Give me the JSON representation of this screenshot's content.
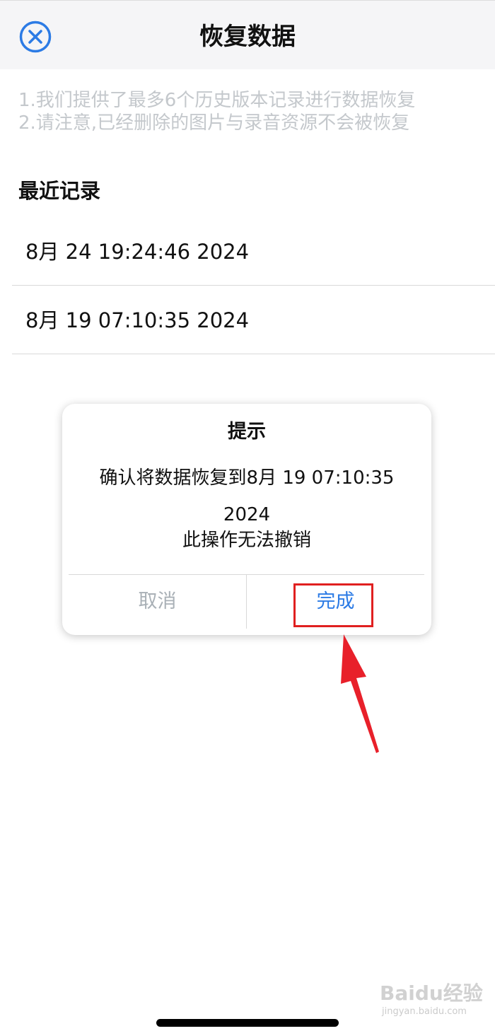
{
  "header": {
    "title": "恢复数据",
    "close_icon": "close-circle-icon",
    "accent_color": "#2c7be5"
  },
  "notes": [
    "1.我们提供了最多6个历史版本记录进行数据恢复",
    "2.请注意,已经删除的图片与录音资源不会被恢复"
  ],
  "recent": {
    "title": "最近记录",
    "records": [
      "8月 24 19:24:46 2024",
      "8月 19 07:10:35 2024"
    ]
  },
  "dialog": {
    "title": "提示",
    "message": "确认将数据恢复到8月 19 07:10:35 2024",
    "sub": "此操作无法撤销",
    "cancel_label": "取消",
    "done_label": "完成"
  },
  "watermark": {
    "text": "Baidu经验",
    "sub": "jingyan.baidu.com"
  }
}
